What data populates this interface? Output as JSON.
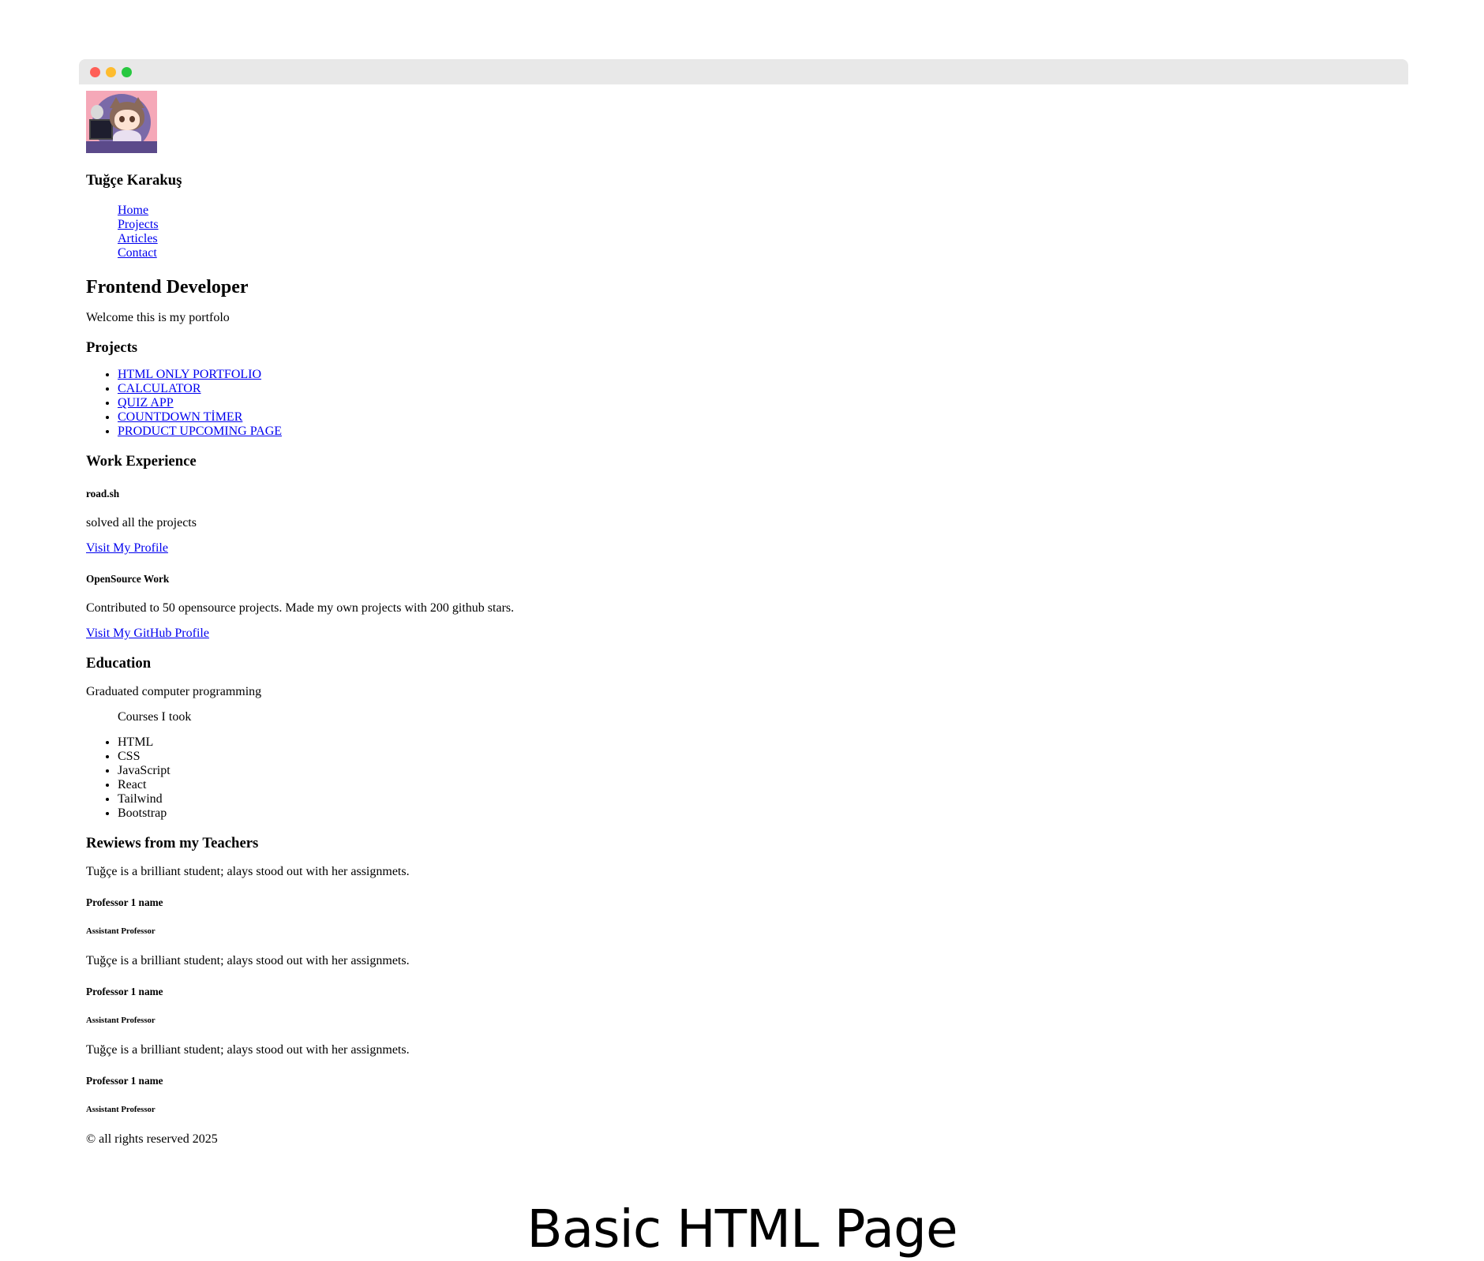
{
  "window": {
    "controls": [
      "close",
      "minimize",
      "maximize"
    ],
    "colors": {
      "close": "#ff5f57",
      "minimize": "#febc2e",
      "maximize": "#28c840",
      "titlebar": "#e8e8e8"
    }
  },
  "profile": {
    "avatar_icon": "anime-girl-with-cat-avatar",
    "name": "Tuğçe Karakuş"
  },
  "nav": [
    "Home",
    "Projects",
    "Articles",
    "Contact"
  ],
  "intro": {
    "title": "Frontend Developer",
    "welcome": "Welcome this is my portfolo"
  },
  "projects": {
    "heading": "Projects",
    "items": [
      "HTML ONLY PORTFOLIO",
      "CALCULATOR",
      "QUIZ APP",
      "COUNTDOWN TİMER",
      "PRODUCT UPCOMING PAGE"
    ]
  },
  "work": {
    "heading": "Work Experience",
    "jobs": [
      {
        "title": "road.sh",
        "desc": "solved all the projects",
        "link": "Visit My Profile"
      },
      {
        "title": "OpenSource Work",
        "desc": "Contributed to 50 opensource projects. Made my own projects with 200 github stars.",
        "link": "Visit My GitHub Profile"
      }
    ]
  },
  "education": {
    "heading": "Education",
    "text": "Graduated computer programming",
    "courses_label": "Courses I took",
    "courses": [
      "HTML",
      "CSS",
      "JavaScript",
      "React",
      "Tailwind",
      "Bootstrap"
    ]
  },
  "reviews": {
    "heading": "Rewiews from my Teachers",
    "items": [
      {
        "quote": "Tuğçe is a brilliant student; alays stood out with her assignmets.",
        "name": "Professor 1 name",
        "role": "Assistant Professor"
      },
      {
        "quote": "Tuğçe is a brilliant student; alays stood out with her assignmets.",
        "name": "Professor 1 name",
        "role": "Assistant Professor"
      },
      {
        "quote": "Tuğçe is a brilliant student; alays stood out with her assignmets.",
        "name": "Professor 1 name",
        "role": "Assistant Professor"
      }
    ]
  },
  "footer": "© all rights reserved 2025",
  "caption": "Basic HTML Page"
}
